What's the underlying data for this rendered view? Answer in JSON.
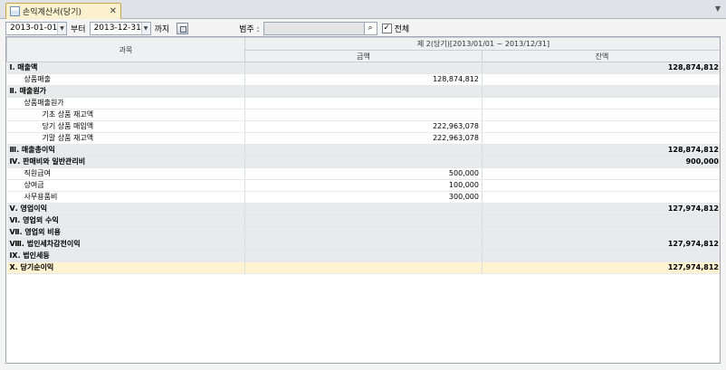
{
  "tab": {
    "title": "손익계산서(당기)",
    "close": "✕",
    "menu": "▼"
  },
  "toolbar": {
    "date_from": "2013-01-01",
    "from_label": "부터",
    "date_to": "2013-12-31",
    "to_label": "까지",
    "category_label": "범주 :",
    "category_value": "",
    "search_icon": "⌕",
    "all_checked": "✓",
    "all_label": "전체"
  },
  "grid": {
    "col_item": "과목",
    "col_period": "제 2(당기)[2013/01/01 ~ 2013/12/31]",
    "col_amount": "금액",
    "col_balance": "잔액",
    "rows": [
      {
        "type": "sec",
        "level": 1,
        "item": "Ⅰ. 매출액",
        "amount": "",
        "balance": "128,874,812"
      },
      {
        "type": "sub",
        "level": 2,
        "item": "상품매출",
        "amount": "128,874,812",
        "balance": ""
      },
      {
        "type": "sec",
        "level": 1,
        "item": "Ⅱ. 매출원가",
        "amount": "",
        "balance": ""
      },
      {
        "type": "sub",
        "level": 2,
        "item": "상품매출원가",
        "amount": "",
        "balance": ""
      },
      {
        "type": "sub",
        "level": 3,
        "item": "기초 상품 재고액",
        "amount": "",
        "balance": ""
      },
      {
        "type": "sub",
        "level": 3,
        "item": "당기 상품 매입액",
        "amount": "222,963,078",
        "balance": ""
      },
      {
        "type": "sub",
        "level": 3,
        "item": "기말 상품 재고액",
        "amount": "222,963,078",
        "balance": ""
      },
      {
        "type": "sec",
        "level": 1,
        "item": "Ⅲ. 매출총이익",
        "amount": "",
        "balance": "128,874,812"
      },
      {
        "type": "sec",
        "level": 1,
        "item": "Ⅳ. 판매비와 일반관리비",
        "amount": "",
        "balance": "900,000"
      },
      {
        "type": "sub",
        "level": 2,
        "item": "직원급여",
        "amount": "500,000",
        "balance": ""
      },
      {
        "type": "sub",
        "level": 2,
        "item": "상여금",
        "amount": "100,000",
        "balance": ""
      },
      {
        "type": "sub",
        "level": 2,
        "item": "사무용품비",
        "amount": "300,000",
        "balance": ""
      },
      {
        "type": "sec",
        "level": 1,
        "item": "Ⅴ. 영업이익",
        "amount": "",
        "balance": "127,974,812"
      },
      {
        "type": "sec",
        "level": 1,
        "item": "Ⅵ. 영업외 수익",
        "amount": "",
        "balance": ""
      },
      {
        "type": "sec",
        "level": 1,
        "item": "Ⅶ. 영업외 비용",
        "amount": "",
        "balance": ""
      },
      {
        "type": "sec",
        "level": 1,
        "item": "Ⅷ. 법인세차감전이익",
        "amount": "",
        "balance": "127,974,812"
      },
      {
        "type": "sec",
        "level": 1,
        "item": "Ⅸ. 법인세등",
        "amount": "",
        "balance": ""
      },
      {
        "type": "total",
        "level": 1,
        "item": "Ⅹ. 당기순이익",
        "amount": "",
        "balance": "127,974,812"
      }
    ]
  }
}
